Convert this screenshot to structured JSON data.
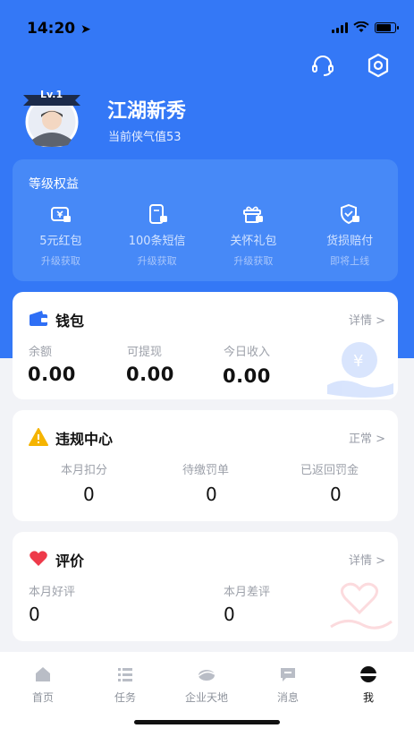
{
  "status": {
    "time": "14:20"
  },
  "profile": {
    "level_badge": "Lv.1",
    "name": "江湖新秀",
    "xiaqi_label": "当前侠气值",
    "xiaqi_value": "53"
  },
  "header_icons": [
    "headset-icon",
    "settings-icon"
  ],
  "benefits": {
    "title": "等级权益",
    "items": [
      {
        "icon": "red-packet-icon",
        "name": "5元红包",
        "sub": "升级获取"
      },
      {
        "icon": "sms-icon",
        "name": "100条短信",
        "sub": "升级获取"
      },
      {
        "icon": "gift-icon",
        "name": "关怀礼包",
        "sub": "升级获取"
      },
      {
        "icon": "shield-icon",
        "name": "货损赔付",
        "sub": "即将上线"
      }
    ]
  },
  "wallet": {
    "title": "钱包",
    "link": "详情 >",
    "columns": [
      {
        "label": "余额",
        "value": "0.00"
      },
      {
        "label": "可提现",
        "value": "0.00"
      },
      {
        "label": "今日收入",
        "value": "0.00"
      }
    ]
  },
  "violation": {
    "title": "违规中心",
    "link": "正常 >",
    "columns": [
      {
        "label": "本月扣分",
        "value": "0"
      },
      {
        "label": "待缴罚单",
        "value": "0"
      },
      {
        "label": "已返回罚金",
        "value": "0"
      }
    ]
  },
  "rating": {
    "title": "评价",
    "link": "详情 >",
    "columns": [
      {
        "label": "本月好评",
        "value": "0"
      },
      {
        "label": "本月差评",
        "value": "0"
      }
    ]
  },
  "tabbar": {
    "items": [
      {
        "icon": "home-icon",
        "label": "首页"
      },
      {
        "icon": "task-list-icon",
        "label": "任务"
      },
      {
        "icon": "enterprise-icon",
        "label": "企业天地"
      },
      {
        "icon": "message-icon",
        "label": "消息"
      },
      {
        "icon": "me-icon",
        "label": "我",
        "active": true
      }
    ]
  },
  "colors": {
    "brand_blue": "#3478f6",
    "panel_blue": "#4789f7",
    "wallet_icon": "#2f6ff5",
    "warning": "#f5b400",
    "heart": "#ee3a4a"
  }
}
